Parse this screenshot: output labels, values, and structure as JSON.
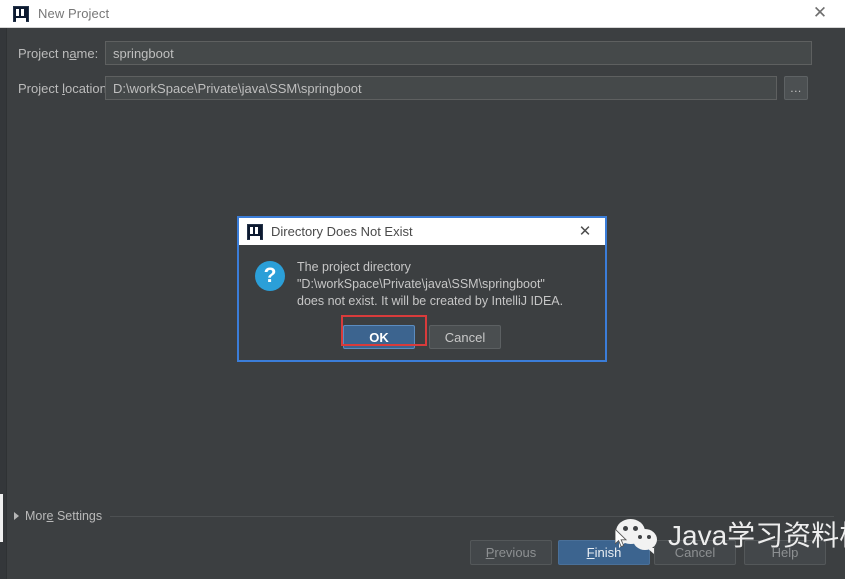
{
  "window": {
    "title": "New Project",
    "icon": "intellij-idea-icon",
    "close_label": "✕"
  },
  "form": {
    "rows": [
      {
        "label_pre": "Project n",
        "label_accel": "a",
        "label_post": "me:",
        "value": "springboot",
        "field_name": "project-name-input"
      },
      {
        "label_pre": "Project ",
        "label_accel": "l",
        "label_post": "ocation:",
        "value": "D:\\workSpace\\Private\\java\\SSM\\springboot",
        "field_name": "project-location-input"
      }
    ],
    "browse_label": "..."
  },
  "more_settings": {
    "label_pre": "Mor",
    "label_accel": "e",
    "label_post": " Settings",
    "expanded": false
  },
  "buttons": [
    {
      "name": "previous-button",
      "label_pre": "",
      "label_accel": "P",
      "label_post": "revious",
      "state": "disabled"
    },
    {
      "name": "finish-button",
      "label_pre": "",
      "label_accel": "F",
      "label_post": "inish",
      "state": "primary"
    },
    {
      "name": "cancel-button",
      "label_pre": "Cancel",
      "label_accel": "",
      "label_post": "",
      "state": "disabled"
    },
    {
      "name": "help-button",
      "label_pre": "Help",
      "label_accel": "",
      "label_post": "",
      "state": "disabled"
    }
  ],
  "dialog": {
    "title": "Directory Does Not Exist",
    "icon": "intellij-idea-icon",
    "close_label": "✕",
    "question_glyph": "?",
    "message_line1": "The project directory",
    "message_line2": "\"D:\\workSpace\\Private\\java\\SSM\\springboot\"",
    "message_line3": "does not exist. It will be created by IntelliJ IDEA.",
    "ok_label": "OK",
    "cancel_label": "Cancel",
    "highlight_color": "#d93b3b",
    "border_color": "#3b7dd8"
  },
  "watermark": {
    "text": "Java学习资料栈",
    "icon": "wechat-icon"
  },
  "colors": {
    "background": "#3c3f41",
    "accent_blue": "#3c648f",
    "titlebar": "#ffffff",
    "field_bg": "#45494a",
    "text": "#bbbbbb"
  }
}
